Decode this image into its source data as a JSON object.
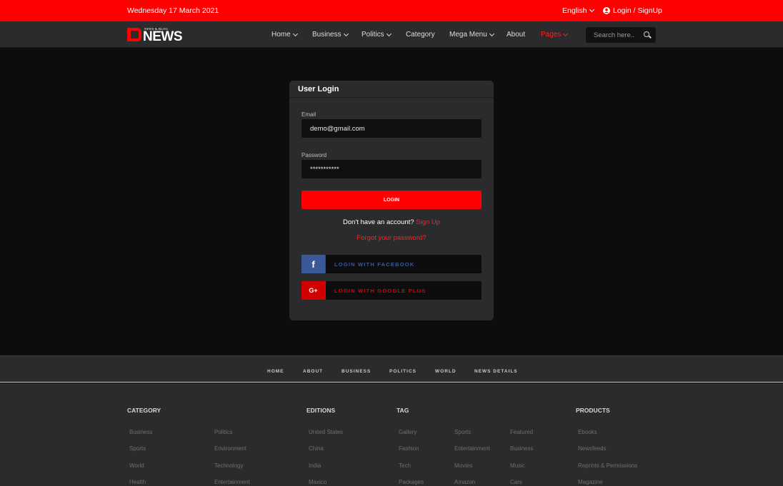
{
  "topbar": {
    "date": "Wednesday 17 March 2021",
    "language": "English",
    "login_label": "Login / SignUp",
    "accent_color": "#ff0000"
  },
  "logo": {
    "tagline": "NEWS & BLOG",
    "brand": "NEWS"
  },
  "nav": {
    "items": [
      {
        "label": "Home",
        "dropdown": true
      },
      {
        "label": "Business",
        "dropdown": true
      },
      {
        "label": "Politics",
        "dropdown": true
      },
      {
        "label": "Category",
        "dropdown": false
      },
      {
        "label": "Mega Menu",
        "dropdown": true
      },
      {
        "label": "About",
        "dropdown": false
      },
      {
        "label": "Pages",
        "dropdown": true,
        "active": true
      }
    ],
    "search_placeholder": "Search here.."
  },
  "login_card": {
    "title": "User Login",
    "email_label": "Email",
    "email_value": "demo@gmail.com",
    "password_label": "Password",
    "password_value": "***********",
    "login_button": "LOGIN",
    "no_account_text": "Don't have an account?",
    "signup_link": "Sign Up",
    "forgot_link": "Forgot your password?",
    "facebook_button": "LOGIN WITH FACEBOOK",
    "facebook_icon_glyph": "f",
    "google_button": "LOGIN WITH GOOGLE PLUS",
    "google_icon_glyph": "G+",
    "facebook_color": "#3b5998",
    "google_color": "#d10000"
  },
  "footer_nav": [
    "HOME",
    "ABOUT",
    "BUSINESS",
    "POLITICS",
    "WORLD",
    "NEWS DETAILS"
  ],
  "footer": {
    "category": {
      "title": "CATEGORY",
      "col1": [
        "Business",
        "Sports",
        "World",
        "Health"
      ],
      "col2": [
        "Politics",
        "Environment",
        "Technology",
        "Entertainment"
      ]
    },
    "editions": {
      "title": "EDITIONS",
      "items": [
        "United States",
        "China",
        "India",
        "Maxico"
      ]
    },
    "tag": {
      "title": "TAG",
      "col1": [
        "Gallery",
        "Fashion",
        "Tech",
        "Packages"
      ],
      "col2": [
        "Sports",
        "Entertainment",
        "Movies",
        "Amazon"
      ],
      "col3": [
        "Featured",
        "Business",
        "Music",
        "Cars"
      ]
    },
    "products": {
      "title": "PRODUCTS",
      "items": [
        "Ebooks",
        "Newsfeeds",
        "Reprints & Permissions",
        "Magazine"
      ]
    }
  }
}
